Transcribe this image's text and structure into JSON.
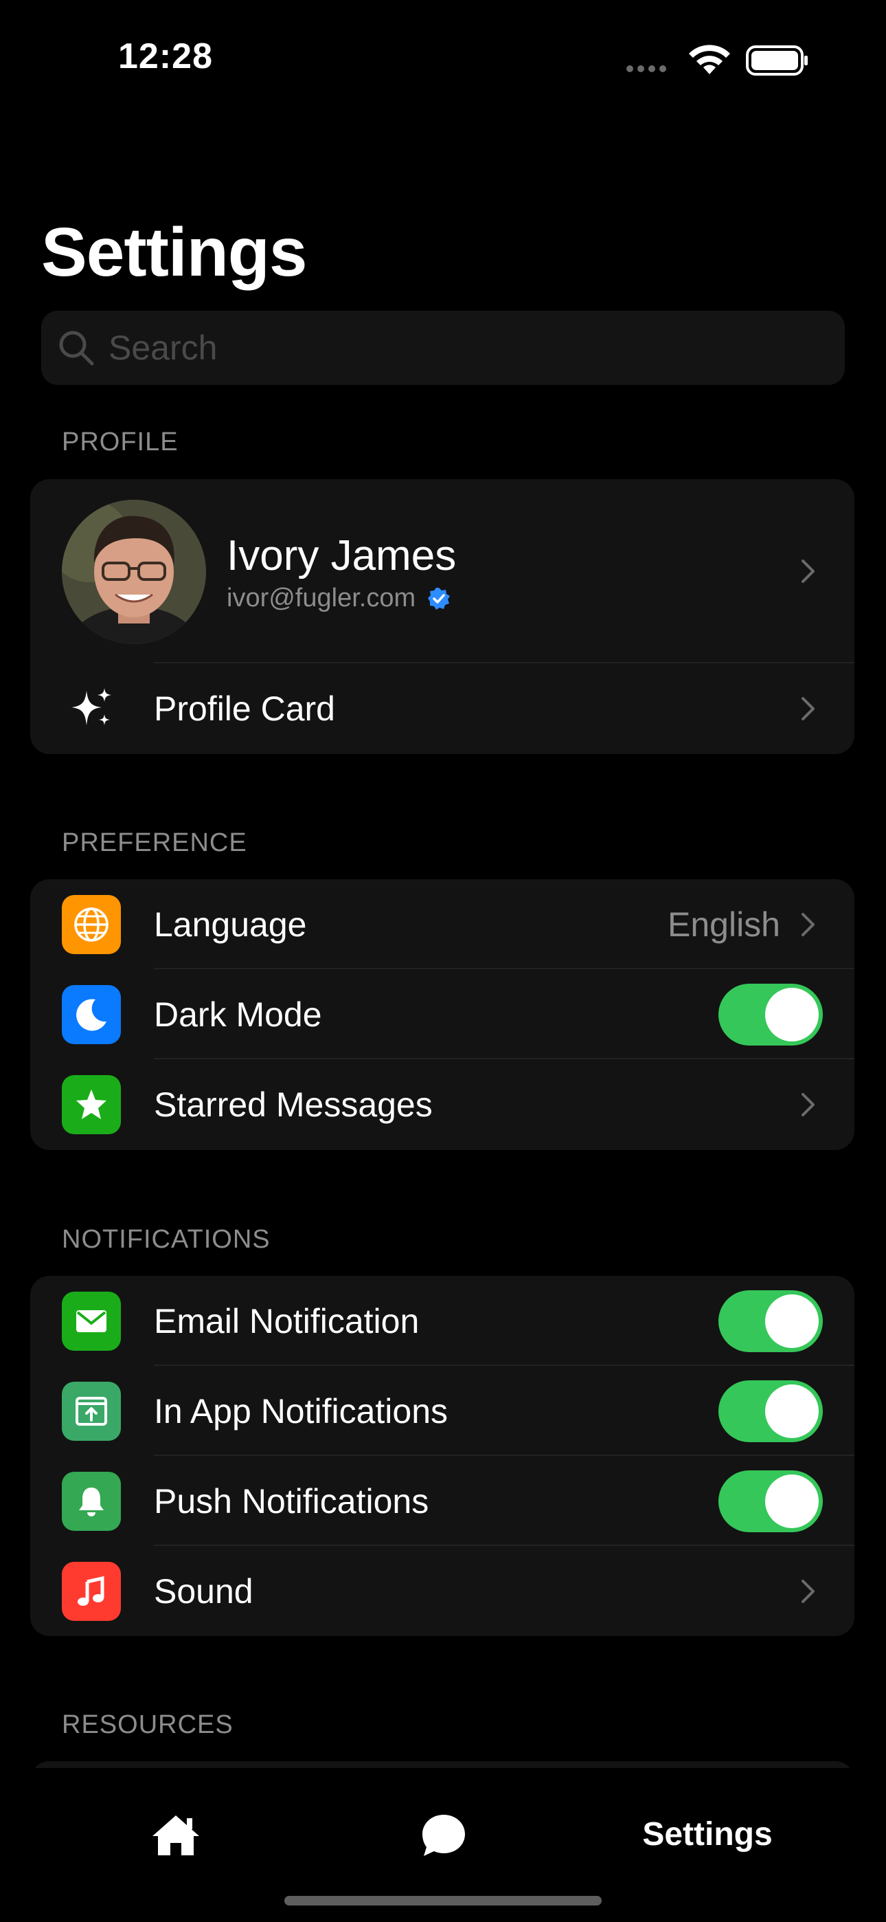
{
  "status_bar": {
    "time": "12:28"
  },
  "page": {
    "title": "Settings"
  },
  "search": {
    "placeholder": "Search"
  },
  "sections": {
    "profile": "PROFILE",
    "preference": "PREFERENCE",
    "notifications": "NOTIFICATIONS",
    "resources": "RESOURCES"
  },
  "profile": {
    "name": "Ivory James",
    "email": "ivor@fugler.com",
    "profile_card_label": "Profile Card"
  },
  "preference": {
    "language_label": "Language",
    "language_value": "English",
    "dark_mode_label": "Dark Mode",
    "dark_mode_on": true,
    "starred_label": "Starred Messages"
  },
  "notifications": {
    "email_label": "Email Notification",
    "email_on": true,
    "in_app_label": "In App Notifications",
    "in_app_on": true,
    "push_label": "Push Notifications",
    "push_on": true,
    "sound_label": "Sound"
  },
  "tabbar": {
    "home_icon": "house-icon",
    "chat_icon": "chat-bubble-icon",
    "settings_label": "Settings"
  },
  "colors": {
    "toggle_on": "#35c759",
    "language_icon_bg": "#ff9500",
    "dark_mode_icon_bg": "#0a7aff",
    "starred_icon_bg": "#1aad19",
    "email_icon_bg": "#1aad19",
    "in_app_icon_bg": "#3aa867",
    "push_icon_bg": "#34a853",
    "sound_icon_bg": "#ff3b30",
    "verified_badge": "#2d8cff"
  }
}
